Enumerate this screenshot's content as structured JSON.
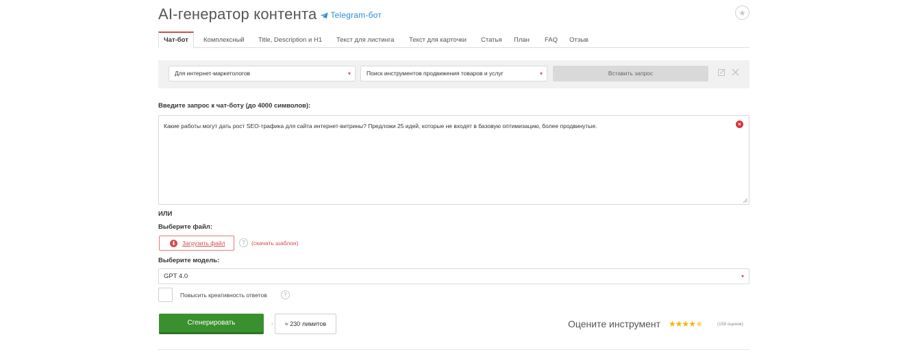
{
  "header": {
    "title": "AI-генератор контента",
    "telegram_label": "Telegram-бот"
  },
  "tabs": [
    {
      "label": "Чат-бот",
      "active": true
    },
    {
      "label": "Комплексный"
    },
    {
      "label": "Title, Description и H1"
    },
    {
      "label": "Текст для листинга"
    },
    {
      "label": "Текст для карточки"
    },
    {
      "label": "Статья"
    },
    {
      "label": "План"
    },
    {
      "label": "FAQ"
    },
    {
      "label": "Отзыв"
    }
  ],
  "query_panel": {
    "audience_select": "Для интернет-маркетологов",
    "template_select": "Поиск инструментов продвижения товаров и услуг",
    "insert_button": "Вставить запрос"
  },
  "prompt": {
    "label": "Введите запрос к чат-боту (до 4000 символов):",
    "value": "Какие работы могут дать рост SEO-трафика для сайта интернет-витрины? Предложи 25 идей, которые не входят в базовую оптимизацию, более продвинутые."
  },
  "or_label": "или",
  "file": {
    "label": "Выберите файл:",
    "upload_button": "Загрузить файл",
    "help": "?",
    "template_link": "(скачать шаблон)"
  },
  "model": {
    "label": "Выберите модель:",
    "selected": "GPT 4.0"
  },
  "creativity": {
    "label": "Повысить креативность ответов",
    "checked": false,
    "help": "?"
  },
  "actions": {
    "generate_button": "Сгенерировать",
    "limits": "≈ 230 лимитов"
  },
  "rating": {
    "label": "Оцените инструмент",
    "stars": 4.5,
    "count_text": "(158 оценок)",
    "star_color": "#f5b301"
  },
  "colors": {
    "accent_red": "#d34b4b",
    "generate_green": "#3a8f2e",
    "telegram_blue": "#2a8bd6"
  },
  "icons": {
    "telegram": "telegram-plane-icon",
    "favorite": "star-outline-icon",
    "edit": "edit-icon",
    "close": "close-icon",
    "clear": "clear-circle-icon",
    "upload": "upload-circle-icon"
  }
}
